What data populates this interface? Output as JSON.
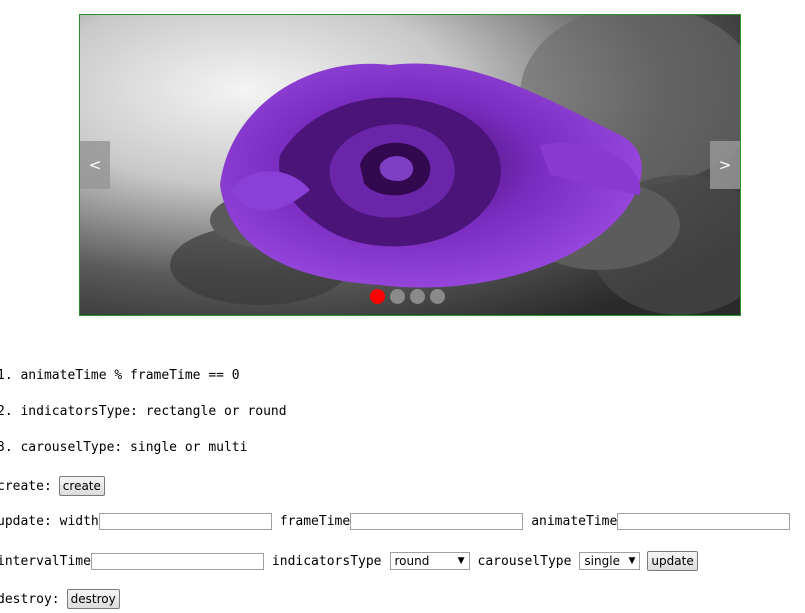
{
  "carousel": {
    "prev_label": "<",
    "next_label": ">",
    "indicator_count": 4,
    "active_index": 0,
    "image_icon": "purple-rose-photo",
    "colors": {
      "active_dot": "#ff0000",
      "inactive_dot": "#8a8a8a",
      "border": "#2f8f2f"
    }
  },
  "notes": [
    "1. animateTime % frameTime == 0",
    "2. indicatorsType: rectangle or round",
    "3. carouselType: single or multi"
  ],
  "create": {
    "label": "create:",
    "button": "create"
  },
  "update": {
    "label": "update: width",
    "width_value": "",
    "frameTime_label": "frameTime",
    "frameTime_value": "",
    "animateTime_label": "animateTime",
    "animateTime_value": "",
    "intervalTime_label": "intervalTime",
    "intervalTime_value": "",
    "indicatorsType_label": "indicatorsType",
    "indicatorsType_value": "round",
    "carouselType_label": "carouselType",
    "carouselType_value": "single",
    "button": "update"
  },
  "destroy": {
    "label": "destroy:",
    "button": "destroy"
  }
}
